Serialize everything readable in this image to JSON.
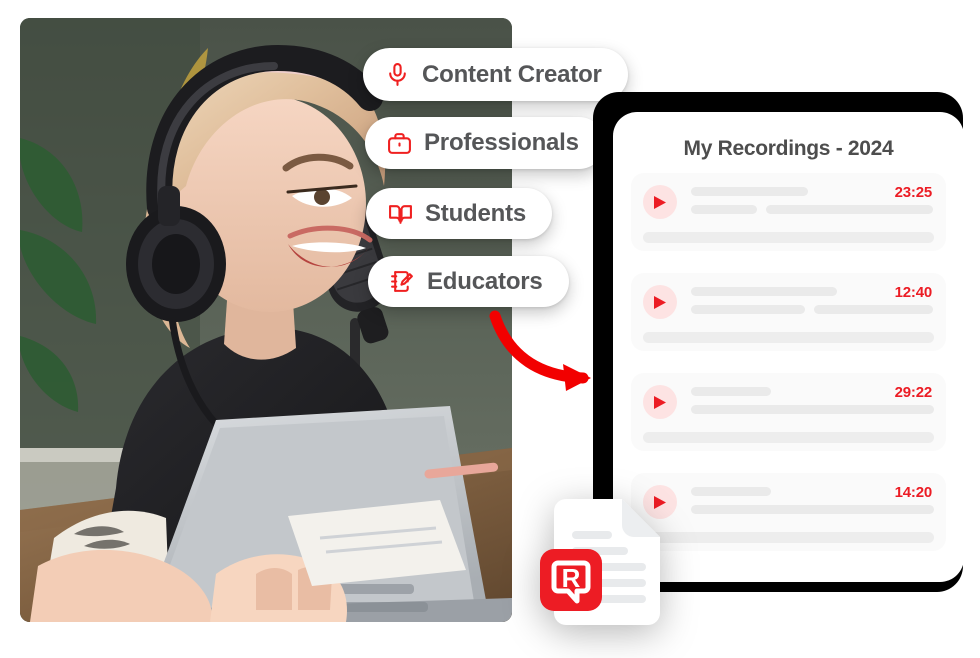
{
  "photo": {
    "alt_description": "Smiling woman with blonde hair wearing black over-ear headphones speaking into a studio microphone while typing on a laptop at a wooden desk",
    "icon": "podcast-photo"
  },
  "audience_pills": [
    {
      "label": "Content Creator",
      "icon": "microphone-icon"
    },
    {
      "label": "Professionals",
      "icon": "briefcase-icon"
    },
    {
      "label": "Students",
      "icon": "open-book-icon"
    },
    {
      "label": "Educators",
      "icon": "notepad-pencil-icon"
    }
  ],
  "arrow": {
    "icon": "curved-arrow-icon"
  },
  "recordings_panel": {
    "title": "My Recordings - 2024",
    "rows": [
      {
        "duration": "23:25",
        "icon": "play-icon",
        "title_bar_width": 48,
        "sub_bar_a_width": 27,
        "sub_bar_b_width": 69
      },
      {
        "duration": "12:40",
        "icon": "play-icon",
        "title_bar_width": 60,
        "sub_bar_a_width": 47,
        "sub_bar_b_width": 49
      },
      {
        "duration": "29:22",
        "icon": "play-icon",
        "title_bar_width": 33,
        "sub_bar_a_width": 100,
        "sub_bar_b_width": 0
      },
      {
        "duration": "14:20",
        "icon": "play-icon",
        "title_bar_width": 33,
        "sub_bar_a_width": 100,
        "sub_bar_b_width": 0
      }
    ]
  },
  "document_badge": {
    "icon": "document-icon",
    "badge_icon": "r-speech-bubble-icon",
    "badge_letter": "R"
  },
  "colors": {
    "accent_red": "#ec1c24",
    "icon_red": "#ef2020",
    "play_bg": "#fde3e3",
    "title_gray": "#4d4d4d",
    "label_gray": "#555658",
    "bar_gray": "#eaeaea",
    "row_bg": "#fafafa",
    "backdrop_black": "#000000"
  }
}
